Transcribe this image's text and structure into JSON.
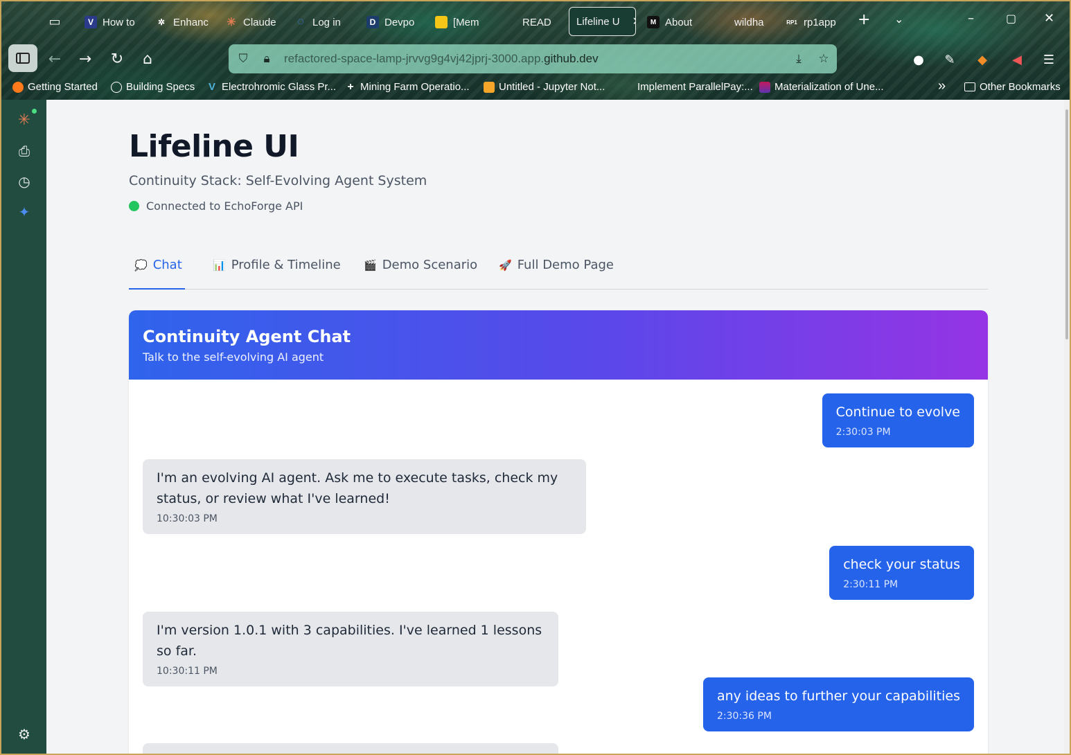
{
  "browser": {
    "tabs": [
      {
        "label": "How to",
        "icon": "V",
        "icon_bg": "#2b3a8a"
      },
      {
        "label": "Enhanc",
        "icon": "✲",
        "icon_bg": "transparent"
      },
      {
        "label": "Claude",
        "icon": "✳",
        "icon_bg": "transparent"
      },
      {
        "label": "Log in",
        "icon": "◌",
        "icon_bg": "transparent"
      },
      {
        "label": "Devpo",
        "icon": "D",
        "icon_bg": "#1c3c6b"
      },
      {
        "label": "[Mem",
        "icon": "▬",
        "icon_bg": "#f5c518"
      },
      {
        "label": "READ",
        "icon": "",
        "icon_bg": "transparent"
      },
      {
        "label": "Lifeline U",
        "icon": "",
        "icon_bg": "transparent",
        "active": true
      },
      {
        "label": "About",
        "icon": "M",
        "icon_bg": "#111"
      },
      {
        "label": "wildha",
        "icon": "",
        "icon_bg": "transparent"
      },
      {
        "label": "rp1app",
        "icon": "RP1",
        "icon_bg": "transparent"
      }
    ],
    "url": {
      "dim": "refactored-space-lamp-jrvvg9g4vj42jprj-3000.app.",
      "domain": "github.dev"
    },
    "bookmarks": [
      {
        "label": "Getting Started",
        "icon": "firefox-icon"
      },
      {
        "label": "Building Specs",
        "icon": "globe-icon"
      },
      {
        "label": "Electrohromic Glass Pr...",
        "icon": "v-icon"
      },
      {
        "label": "Mining Farm Operatio...",
        "icon": "plus-icon"
      },
      {
        "label": "Untitled - Jupyter Not...",
        "icon": "notebook-icon"
      },
      {
        "label": "Implement ParallelPay:...",
        "icon": "blank-icon"
      },
      {
        "label": "Materialization of Une...",
        "icon": "image-icon"
      }
    ],
    "other_bookmarks": "Other Bookmarks",
    "more_bookmarks": "»"
  },
  "app": {
    "title": "Lifeline UI",
    "subtitle": "Continuity Stack: Self-Evolving Agent System",
    "status_text": "Connected to EchoForge API",
    "status_color": "#22c55e",
    "tabs": [
      {
        "emoji": "💭",
        "label": "Chat",
        "active": true
      },
      {
        "emoji": "📊",
        "label": "Profile & Timeline"
      },
      {
        "emoji": "🎬",
        "label": "Demo Scenario"
      },
      {
        "emoji": "🚀",
        "label": "Full Demo Page"
      }
    ],
    "chat": {
      "title": "Continuity Agent Chat",
      "subtitle": "Talk to the self-evolving AI agent",
      "messages": [
        {
          "role": "user",
          "text": "Continue to evolve",
          "time": "2:30:03 PM"
        },
        {
          "role": "agent",
          "text": "I'm an evolving AI agent. Ask me to execute tasks, check my status, or review what I've learned!",
          "time": "10:30:03 PM"
        },
        {
          "role": "user",
          "text": "check your status",
          "time": "2:30:11 PM"
        },
        {
          "role": "agent",
          "text": "I'm version 1.0.1 with 3 capabilities. I've learned 1 lessons so far.",
          "time": "10:30:11 PM"
        },
        {
          "role": "user",
          "text": "any ideas to further your capabilities",
          "time": "2:30:36 PM"
        }
      ]
    }
  },
  "colors": {
    "accent": "#2563eb",
    "gradient_start": "#2f64ec",
    "gradient_end": "#9534e4"
  }
}
